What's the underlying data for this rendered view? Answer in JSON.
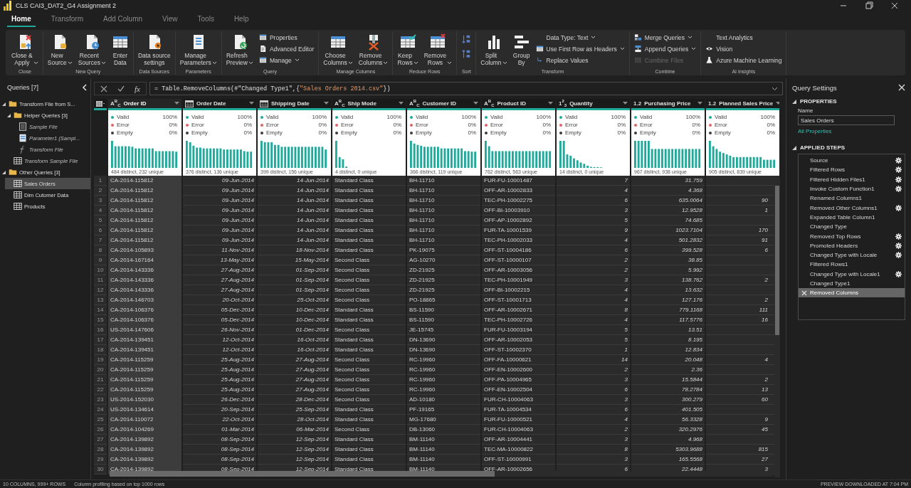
{
  "window": {
    "title": "CLS CAI3_DAT2_G4 Assignment 2"
  },
  "tabs": [
    {
      "label": "Home",
      "selected": true
    },
    {
      "label": "Transform",
      "selected": false
    },
    {
      "label": "Add Column",
      "selected": false
    },
    {
      "label": "View",
      "selected": false
    },
    {
      "label": "Tools",
      "selected": false
    },
    {
      "label": "Help",
      "selected": false
    }
  ],
  "ribbon": {
    "groups": [
      {
        "title": "Close",
        "items": [
          {
            "kind": "large",
            "label": "Close &\nApply",
            "dropdown": true,
            "disabled": false
          }
        ]
      },
      {
        "title": "New Query",
        "items": [
          {
            "kind": "large",
            "label": "New\nSource",
            "dropdown": true,
            "disabled": false
          },
          {
            "kind": "large",
            "label": "Recent\nSources",
            "dropdown": true,
            "disabled": false
          },
          {
            "kind": "large",
            "label": "Enter\nData",
            "dropdown": false,
            "disabled": false
          }
        ]
      },
      {
        "title": "Data Sources",
        "items": [
          {
            "kind": "large",
            "label": "Data source\nsettings",
            "dropdown": false,
            "disabled": false
          }
        ]
      },
      {
        "title": "Parameters",
        "items": [
          {
            "kind": "large",
            "label": "Manage\nParameters",
            "dropdown": true,
            "disabled": false
          }
        ]
      },
      {
        "title": "Query",
        "items": [
          {
            "kind": "large",
            "label": "Refresh\nPreview",
            "dropdown": true,
            "disabled": false
          },
          {
            "kind": "small",
            "label": "Properties",
            "dropdown": false,
            "disabled": false
          },
          {
            "kind": "small",
            "label": "Advanced Editor",
            "dropdown": false,
            "disabled": false
          },
          {
            "kind": "small",
            "label": "Manage",
            "dropdown": true,
            "disabled": false
          }
        ]
      },
      {
        "title": "Manage Columns",
        "items": [
          {
            "kind": "large",
            "label": "Choose\nColumns",
            "dropdown": true,
            "disabled": false
          },
          {
            "kind": "large",
            "label": "Remove\nColumns",
            "dropdown": true,
            "disabled": false
          }
        ]
      },
      {
        "title": "Reduce Rows",
        "items": [
          {
            "kind": "large",
            "label": "Keep\nRows",
            "dropdown": true,
            "disabled": false
          },
          {
            "kind": "large",
            "label": "Remove\nRows",
            "dropdown": true,
            "disabled": false
          }
        ]
      },
      {
        "title": "Sort",
        "items": [
          {
            "kind": "icon",
            "dropdown": false,
            "disabled": false
          },
          {
            "kind": "icon",
            "dropdown": false,
            "disabled": false
          }
        ]
      },
      {
        "title": "Transform",
        "items": [
          {
            "kind": "large",
            "label": "Split\nColumn",
            "dropdown": true,
            "disabled": false
          },
          {
            "kind": "large",
            "label": "Group\nBy",
            "dropdown": false,
            "disabled": false
          },
          {
            "kind": "small",
            "label": "Data Type: Text",
            "dropdown": true,
            "disabled": false
          },
          {
            "kind": "small",
            "label": "Use First Row as Headers",
            "dropdown": true,
            "disabled": false
          },
          {
            "kind": "small",
            "label": "Replace Values",
            "dropdown": false,
            "disabled": false
          }
        ]
      },
      {
        "title": "Combine",
        "items": [
          {
            "kind": "small",
            "label": "Merge Queries",
            "dropdown": true,
            "disabled": false
          },
          {
            "kind": "small",
            "label": "Append Queries",
            "dropdown": true,
            "disabled": false
          },
          {
            "kind": "small",
            "label": "Combine Files",
            "dropdown": false,
            "disabled": true
          }
        ]
      },
      {
        "title": "AI Insights",
        "items": [
          {
            "kind": "small",
            "label": "Text Analytics",
            "dropdown": false,
            "disabled": false
          },
          {
            "kind": "small",
            "label": "Vision",
            "dropdown": false,
            "disabled": false
          },
          {
            "kind": "small",
            "label": "Azure Machine Learning",
            "dropdown": false,
            "disabled": false
          }
        ]
      }
    ]
  },
  "queries": {
    "title": "Queries [7]",
    "items": [
      {
        "kind": "folder",
        "label": "Transform File from S...",
        "expanded": true,
        "selected": false,
        "children": [
          {
            "kind": "folder",
            "label": "Helper Queries [3]",
            "expanded": true,
            "selected": false,
            "children": [
              {
                "kind": "file",
                "label": "Sample File",
                "load_enabled": false,
                "selected": false
              },
              {
                "kind": "parameter",
                "label": "Parameter1 (Sampl...",
                "load_enabled": false,
                "selected": false
              },
              {
                "kind": "function",
                "label": "Transform File",
                "load_enabled": false,
                "selected": false
              }
            ]
          },
          {
            "kind": "table",
            "label": "Transform Sample File",
            "load_enabled": false,
            "selected": false
          }
        ]
      },
      {
        "kind": "folder",
        "label": "Other Queries [3]",
        "expanded": true,
        "selected": false,
        "children": [
          {
            "kind": "table",
            "label": "Sales Orders",
            "load_enabled": true,
            "selected": true
          },
          {
            "kind": "table",
            "label": "Dim Cutomer Data",
            "load_enabled": true,
            "selected": false
          },
          {
            "kind": "table",
            "label": "Products",
            "load_enabled": true,
            "selected": false
          }
        ]
      }
    ]
  },
  "formula_bar": {
    "fx": "fx",
    "parts": [
      {
        "kind": "code",
        "text": "= Table.RemoveColumns(#\"Changed Type1\",{"
      },
      {
        "kind": "string",
        "text": "\"Sales Orders 2014.csv\""
      },
      {
        "kind": "code",
        "text": "})"
      }
    ]
  },
  "table": {
    "columns": [
      {
        "name": "Order ID",
        "kind": "text",
        "type_glyph": "A$^{B}$$_{C}$",
        "selected": true,
        "profile": [
          {
            "label": "Valid",
            "value": "100%",
            "color": "#1fa99b"
          },
          {
            "label": "Error",
            "value": "0%",
            "color": "#e06060"
          },
          {
            "label": "Empty",
            "value": "0%",
            "color": "#3a3a3a"
          }
        ],
        "distinct": "484 distinct, 232 unique"
      },
      {
        "name": "Order Date",
        "kind": "date",
        "selected": false,
        "profile": [
          {
            "label": "Valid",
            "value": "100%",
            "color": "#1fa99b"
          },
          {
            "label": "Error",
            "value": "0%",
            "color": "#e06060"
          },
          {
            "label": "Empty",
            "value": "0%",
            "color": "#3a3a3a"
          }
        ],
        "distinct": "376 distinct, 136 unique"
      },
      {
        "name": "Shipping Date",
        "kind": "date",
        "selected": false,
        "profile": [
          {
            "label": "Valid",
            "value": "100%",
            "color": "#1fa99b"
          },
          {
            "label": "Error",
            "value": "0%",
            "color": "#e06060"
          },
          {
            "label": "Empty",
            "value": "0%",
            "color": "#3a3a3a"
          }
        ],
        "distinct": "399 distinct, 156 unique"
      },
      {
        "name": "Ship Mode",
        "kind": "text",
        "type_glyph": "A$^{B}$$_{C}$",
        "selected": false,
        "profile": [
          {
            "label": "Valid",
            "value": "100%",
            "color": "#1fa99b"
          },
          {
            "label": "Error",
            "value": "0%",
            "color": "#e06060"
          },
          {
            "label": "Empty",
            "value": "0%",
            "color": "#3a3a3a"
          }
        ],
        "distinct": "4 distinct, 0 unique"
      },
      {
        "name": "Customer ID",
        "kind": "text",
        "type_glyph": "A$^{B}$$_{C}$",
        "selected": false,
        "profile": [
          {
            "label": "Valid",
            "value": "100%",
            "color": "#1fa99b"
          },
          {
            "label": "Error",
            "value": "0%",
            "color": "#e06060"
          },
          {
            "label": "Empty",
            "value": "0%",
            "color": "#3a3a3a"
          }
        ],
        "distinct": "366 distinct, 119 unique"
      },
      {
        "name": "Product ID",
        "kind": "text",
        "type_glyph": "A$^{B}$$_{C}$",
        "selected": false,
        "profile": [
          {
            "label": "Valid",
            "value": "100%",
            "color": "#1fa99b"
          },
          {
            "label": "Error",
            "value": "0%",
            "color": "#e06060"
          },
          {
            "label": "Empty",
            "value": "0%",
            "color": "#3a3a3a"
          }
        ],
        "distinct": "762 distinct, 563 unique"
      },
      {
        "name": "Quantity",
        "kind": "whole",
        "type_glyph": "1$^{2}$$_{3}$",
        "selected": false,
        "profile": [
          {
            "label": "Valid",
            "value": "100%",
            "color": "#1fa99b"
          },
          {
            "label": "Error",
            "value": "0%",
            "color": "#e06060"
          },
          {
            "label": "Empty",
            "value": "0%",
            "color": "#3a3a3a"
          }
        ],
        "distinct": "14 distinct, 0 unique"
      },
      {
        "name": "Purchasing Price",
        "kind": "decimal",
        "type_glyph": "1.2",
        "selected": false,
        "profile": [
          {
            "label": "Valid",
            "value": "100%",
            "color": "#1fa99b"
          },
          {
            "label": "Error",
            "value": "0%",
            "color": "#e06060"
          },
          {
            "label": "Empty",
            "value": "0%",
            "color": "#3a3a3a"
          }
        ],
        "distinct": "967 distinct, 938 unique"
      },
      {
        "name": "Planned Sales Price",
        "kind": "decimal",
        "type_glyph": "1.2",
        "selected": false,
        "profile": [
          {
            "label": "Valid",
            "value": "100%",
            "color": "#1fa99b"
          },
          {
            "label": "Error",
            "value": "0%",
            "color": "#e06060"
          },
          {
            "label": "Empty",
            "value": "0%",
            "color": "#3a3a3a"
          }
        ],
        "distinct": "905 distinct, 839 unique"
      }
    ],
    "rows": [
      {
        "number": "1",
        "cells": [
          "CA-2014-115812",
          "09-Jun-2014",
          "14-Jun-2014",
          "Standard Class",
          "BH-11710",
          "FUR-FU-10001487",
          "7",
          "31.759"
        ]
      },
      {
        "number": "2",
        "cells": [
          "CA-2014-115812",
          "09-Jun-2014",
          "14-Jun-2014",
          "Standard Class",
          "BH-11710",
          "OFF-AR-10002833",
          "4",
          "4.368"
        ]
      },
      {
        "number": "3",
        "cells": [
          "CA-2014-115812",
          "09-Jun-2014",
          "14-Jun-2014",
          "Standard Class",
          "BH-11710",
          "TEC-PH-10002275",
          "6",
          "635.0064",
          "90"
        ]
      },
      {
        "number": "4",
        "cells": [
          "CA-2014-115812",
          "09-Jun-2014",
          "14-Jun-2014",
          "Standard Class",
          "BH-11710",
          "OFF-BI-10003910",
          "3",
          "12.9528",
          "1"
        ]
      },
      {
        "number": "5",
        "cells": [
          "CA-2014-115812",
          "09-Jun-2014",
          "14-Jun-2014",
          "Standard Class",
          "BH-11710",
          "OFF-AP-10002892",
          "5",
          "74.685"
        ]
      },
      {
        "number": "6",
        "cells": [
          "CA-2014-115812",
          "09-Jun-2014",
          "14-Jun-2014",
          "Standard Class",
          "BH-11710",
          "FUR-TA-10001539",
          "9",
          "1023.7104",
          "170"
        ]
      },
      {
        "number": "7",
        "cells": [
          "CA-2014-115812",
          "09-Jun-2014",
          "14-Jun-2014",
          "Standard Class",
          "BH-11710",
          "TEC-PH-10002033",
          "4",
          "501.2832",
          "91"
        ]
      },
      {
        "number": "8",
        "cells": [
          "CA-2014-105893",
          "11-Nov-2014",
          "18-Nov-2014",
          "Standard Class",
          "PK-19075",
          "OFF-ST-10004186",
          "6",
          "399.528",
          "6"
        ]
      },
      {
        "number": "9",
        "cells": [
          "CA-2014-167164",
          "13-May-2014",
          "15-May-2014",
          "Second Class",
          "AG-10270",
          "OFF-ST-10000107",
          "2",
          "38.85"
        ]
      },
      {
        "number": "10",
        "cells": [
          "CA-2014-143336",
          "27-Aug-2014",
          "01-Sep-2014",
          "Second Class",
          "ZD-21925",
          "OFF-AR-10003056",
          "2",
          "5.992"
        ]
      },
      {
        "number": "11",
        "cells": [
          "CA-2014-143336",
          "27-Aug-2014",
          "01-Sep-2014",
          "Second Class",
          "ZD-21925",
          "TEC-PH-10001949",
          "3",
          "138.762",
          "2"
        ]
      },
      {
        "number": "12",
        "cells": [
          "CA-2014-143336",
          "27-Aug-2014",
          "01-Sep-2014",
          "Second Class",
          "ZD-21925",
          "OFF-BI-10002215",
          "4",
          "13.632"
        ]
      },
      {
        "number": "13",
        "cells": [
          "CA-2014-146703",
          "20-Oct-2014",
          "25-Oct-2014",
          "Second Class",
          "PO-18865",
          "OFF-ST-10001713",
          "4",
          "127.176",
          "2"
        ]
      },
      {
        "number": "14",
        "cells": [
          "CA-2014-106376",
          "05-Dec-2014",
          "10-Dec-2014",
          "Standard Class",
          "BS-11590",
          "OFF-AR-10002671",
          "8",
          "779.1168",
          "111"
        ]
      },
      {
        "number": "15",
        "cells": [
          "CA-2014-106376",
          "05-Dec-2014",
          "10-Dec-2014",
          "Standard Class",
          "BS-11590",
          "TEC-PH-10002726",
          "4",
          "117.5776",
          "16"
        ]
      },
      {
        "number": "16",
        "cells": [
          "US-2014-147606",
          "26-Nov-2014",
          "01-Dec-2014",
          "Second Class",
          "JE-15745",
          "FUR-FU-10003194",
          "5",
          "13.51"
        ]
      },
      {
        "number": "17",
        "cells": [
          "CA-2014-139451",
          "12-Oct-2014",
          "16-Oct-2014",
          "Standard Class",
          "DN-13690",
          "OFF-AR-10002053",
          "5",
          "8.195"
        ]
      },
      {
        "number": "18",
        "cells": [
          "CA-2014-139451",
          "12-Oct-2014",
          "16-Oct-2014",
          "Standard Class",
          "DN-13690",
          "OFF-ST-10002370",
          "1",
          "12.834"
        ]
      },
      {
        "number": "19",
        "cells": [
          "CA-2014-115259",
          "25-Aug-2014",
          "27-Aug-2014",
          "Second Class",
          "RC-19960",
          "OFF-FA-10000621",
          "14",
          "20.048",
          "4"
        ]
      },
      {
        "number": "20",
        "cells": [
          "CA-2014-115259",
          "25-Aug-2014",
          "27-Aug-2014",
          "Second Class",
          "RC-19960",
          "OFF-EN-10002600",
          "2",
          "2.36"
        ]
      },
      {
        "number": "21",
        "cells": [
          "CA-2014-115259",
          "25-Aug-2014",
          "27-Aug-2014",
          "Second Class",
          "RC-19960",
          "OFF-PA-10004965",
          "3",
          "15.5844",
          "2"
        ]
      },
      {
        "number": "22",
        "cells": [
          "CA-2014-115259",
          "25-Aug-2014",
          "27-Aug-2014",
          "Second Class",
          "RC-19960",
          "OFF-EN-10002504",
          "6",
          "78.2784",
          "13"
        ]
      },
      {
        "number": "23",
        "cells": [
          "US-2014-152030",
          "26-Dec-2014",
          "28-Dec-2014",
          "Second Class",
          "AD-10180",
          "FUR-CH-10004063",
          "3",
          "300.279",
          "60"
        ]
      },
      {
        "number": "24",
        "cells": [
          "US-2014-134614",
          "20-Sep-2014",
          "25-Sep-2014",
          "Standard Class",
          "PF-19165",
          "FUR-TA-10004534",
          "6",
          "401.505"
        ]
      },
      {
        "number": "25",
        "cells": [
          "CA-2014-110072",
          "22-Oct-2014",
          "28-Oct-2014",
          "Standard Class",
          "MG-17680",
          "FUR-FU-10000521",
          "4",
          "56.3328",
          "9"
        ]
      },
      {
        "number": "26",
        "cells": [
          "CA-2014-104269",
          "01-Mar-2014",
          "06-Mar-2014",
          "Second Class",
          "DB-13060",
          "FUR-CH-10004063",
          "2",
          "320.2976",
          "45"
        ]
      },
      {
        "number": "27",
        "cells": [
          "CA-2014-139892",
          "08-Sep-2014",
          "12-Sep-2014",
          "Standard Class",
          "BM-11140",
          "OFF-AR-10004441",
          "3",
          "4.968"
        ]
      },
      {
        "number": "28",
        "cells": [
          "CA-2014-139892",
          "08-Sep-2014",
          "12-Sep-2014",
          "Standard Class",
          "BM-11140",
          "TEC-MA-10000822",
          "8",
          "5303.9688",
          "815"
        ]
      },
      {
        "number": "29",
        "cells": [
          "CA-2014-139892",
          "08-Sep-2014",
          "12-Sep-2014",
          "Standard Class",
          "BM-11140",
          "OFF-ST-10000991",
          "3",
          "165.5568",
          "27"
        ]
      },
      {
        "number": "30",
        "cells": [
          "CA-2014-139892",
          "08-Sep-2014",
          "12-Sep-2014",
          "Standard Class",
          "BM-11140",
          "OFF-AR-10002656",
          "6",
          "22.4448",
          "3"
        ]
      }
    ]
  },
  "query_settings": {
    "title": "Query Settings",
    "properties_heading": "PROPERTIES",
    "name_label": "Name",
    "name_value": "Sales Orders",
    "all_properties": "All Properties",
    "steps_heading": "APPLIED STEPS",
    "steps": [
      {
        "label": "Source",
        "settings": true,
        "selected": false
      },
      {
        "label": "Filtered Rows",
        "settings": true,
        "selected": false
      },
      {
        "label": "Filtered Hidden Files1",
        "settings": true,
        "selected": false
      },
      {
        "label": "Invoke Custom Function1",
        "settings": true,
        "selected": false
      },
      {
        "label": "Renamed Columns1",
        "settings": false,
        "selected": false
      },
      {
        "label": "Removed Other Columns1",
        "settings": true,
        "selected": false
      },
      {
        "label": "Expanded Table Column1",
        "settings": false,
        "selected": false
      },
      {
        "label": "Changed Type",
        "settings": false,
        "selected": false
      },
      {
        "label": "Removed Top Rows",
        "settings": true,
        "selected": false
      },
      {
        "label": "Promoted Headers",
        "settings": true,
        "selected": false
      },
      {
        "label": "Changed Type with Locale",
        "settings": true,
        "selected": false
      },
      {
        "label": "Filtered Rows1",
        "settings": false,
        "selected": false
      },
      {
        "label": "Changed Type with Locale1",
        "settings": true,
        "selected": false
      },
      {
        "label": "Changed Type1",
        "settings": false,
        "selected": false
      },
      {
        "label": "Removed Columns",
        "settings": false,
        "selected": true
      }
    ]
  },
  "status_bar": {
    "summary": "10 COLUMNS, 999+ ROWS",
    "profiling": "Column profiling based on top 1000 rows",
    "preview": "PREVIEW DOWNLOADED AT 7:04 PM"
  }
}
